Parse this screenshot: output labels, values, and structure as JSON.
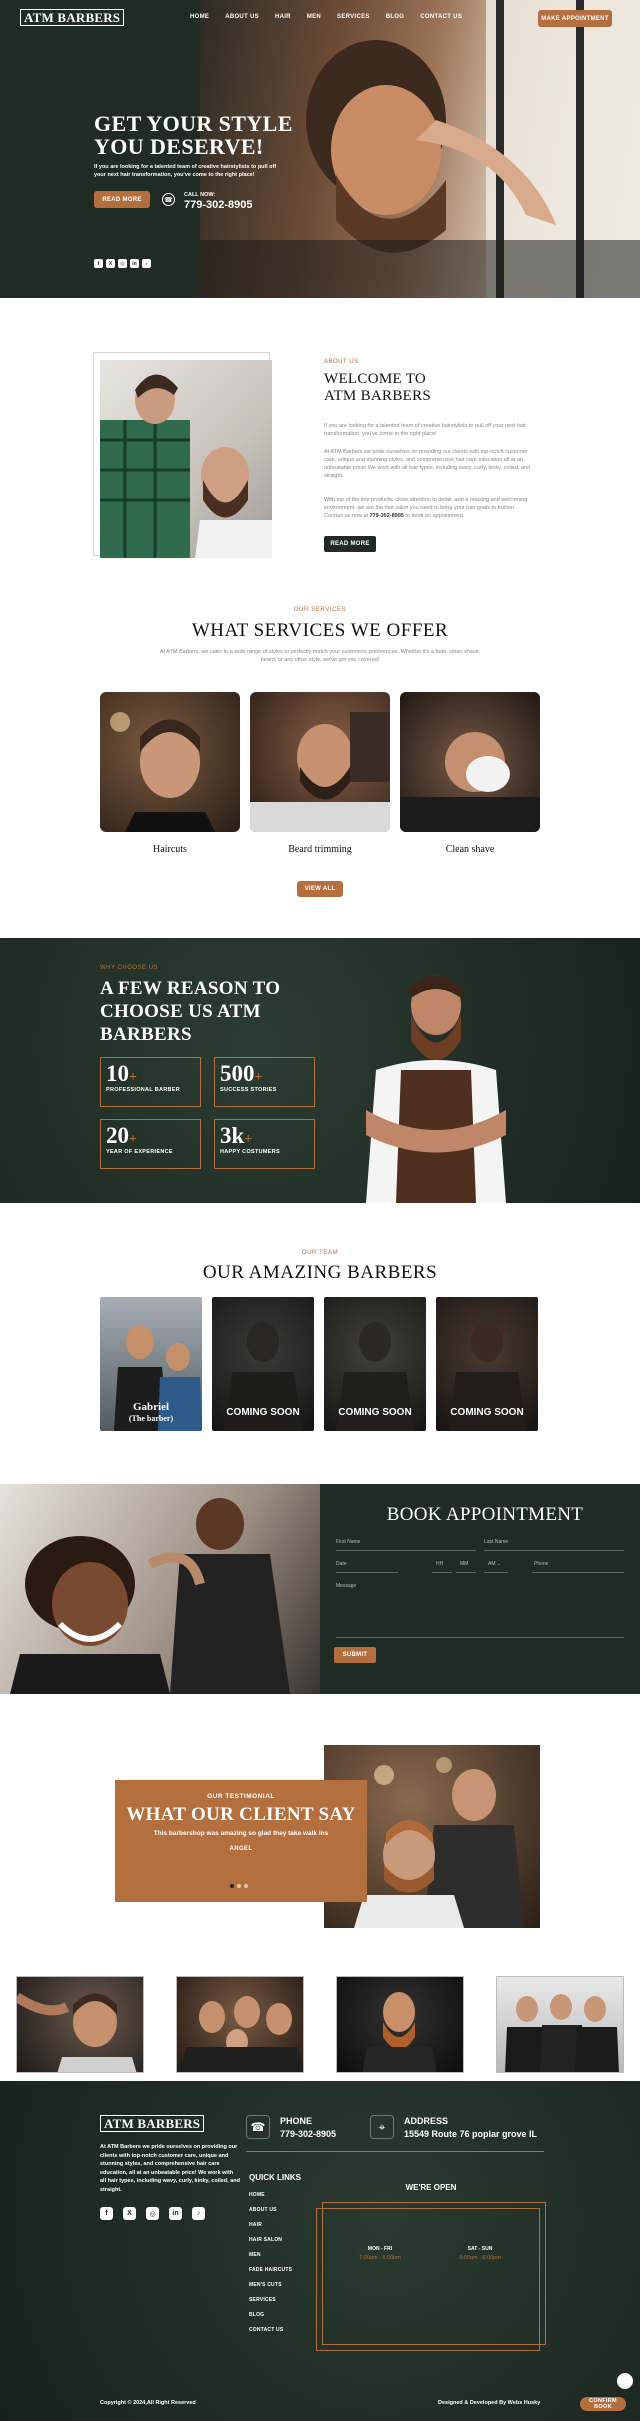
{
  "brand": {
    "logo_text": "ATM BARBERS"
  },
  "nav": {
    "items": [
      "HOME",
      "ABOUT US",
      "HAIR",
      "MEN",
      "SERVICES",
      "BLOG",
      "CONTACT US"
    ],
    "cta": "MAKE APPOINTMENT"
  },
  "hero": {
    "title_line1": "GET YOUR STYLE",
    "title_line2": "YOU DESERVE!",
    "subtitle": "If you are looking for a talented team of creative hairstylists to pull off your next hair transformation, you've come to the right place!",
    "button": "READ MORE",
    "call_label": "CALL NOW:",
    "phone": "779-302-8905",
    "social_icons": [
      "facebook-icon",
      "x-icon",
      "instagram-icon",
      "linkedin-icon",
      "tiktok-icon"
    ]
  },
  "about": {
    "eyebrow": "ABOUT US",
    "title_line1": "WELCOME TO",
    "title_line2": "ATM BARBERS",
    "para1": "If you are looking for a talented team of creative hairstylists to pull off your next hair transformation, you've come to the right place!",
    "para2": "At ATM Barbers we pride ourselves on providing our clients with top-notch customer care, unique and stunning styles, and comprehensive hair care education all at an unbeatable price! We work with all hair types, including wavy, curly, kinky, coiled, and straight.",
    "para3": "With top of the line products, close attention to detail, and a relaxing and welcoming environment, we are the hair salon you need to bring your hair goals to fruition. Contact us now at",
    "para3_phone": "779-302-8905",
    "para3_end": "to book an appointment.",
    "button": "READ MORE"
  },
  "services": {
    "eyebrow": "OUR SERVICES",
    "title": "WHAT SERVICES WE OFFER",
    "intro": "At ATM Barbers, we cater to a wide range of styles to perfectly match your customers preferences. Whether it's a fade, clean shave, beard, or any other style, we've got you covered!",
    "items": [
      "Haircuts",
      "Beard trimming",
      "Clean shave"
    ],
    "button": "VIEW ALL"
  },
  "why": {
    "eyebrow": "WHY CHOOSE US",
    "title_line1": "A FEW REASON TO",
    "title_line2": "CHOOSE US ATM",
    "title_line3": "BARBERS",
    "stats": [
      {
        "value": "10",
        "suffix": "+",
        "label": "PROFESSIONAL BARBER"
      },
      {
        "value": "500",
        "suffix": "+",
        "label": "SUCCESS STORIES"
      },
      {
        "value": "20",
        "suffix": "+",
        "label": "YEAR OF EXPERIENCE"
      },
      {
        "value": "3k",
        "suffix": "+",
        "label": "HAPPY COSTUMERS"
      }
    ]
  },
  "team": {
    "eyebrow": "OUR TEAM",
    "title": "OUR AMAZING BARBERS",
    "members": [
      {
        "name": "Gabriel",
        "role": "(The barber)"
      },
      {
        "name": "COMING SOON",
        "role": ""
      },
      {
        "name": "COMING SOON",
        "role": ""
      },
      {
        "name": "COMING SOON",
        "role": ""
      }
    ]
  },
  "booking": {
    "title": "BOOK APPOINTMENT",
    "first_name": "First Name",
    "last_name": "Last Name",
    "date": "Date",
    "hh": "HH",
    "mm": "MM",
    "ampm": "AM",
    "phone": "Phone",
    "message": "Message",
    "submit": "SUBMIT"
  },
  "testimonial": {
    "eyebrow": "OUR TESTIMONIAL",
    "title": "WHAT OUR CLIENT SAY",
    "quote": "This barbershop was amazing so glad they take walk ins",
    "author": "ANGEL"
  },
  "footer": {
    "logo_text": "ATM BARBERS",
    "about": "At ATM Barbers we pride ourselves on providing our clients with top-notch customer care, unique and stunning styles, and comprehensive hair care education, all at an unbeatable price! We work with all hair types, including wavy, curly, kinky, coiled, and straight.",
    "phone_label": "PHONE",
    "phone": "779-302-8905",
    "address_label": "ADDRESS",
    "address": "15549 Route 76 poplar grove IL",
    "quick_links_title": "QUICK LINKS",
    "quick_links": [
      "HOME",
      "ABOUT US",
      "HAIR",
      "HAIR SALON",
      "MEN",
      "FADE HAIRCUTS",
      "MEN'S CUTS",
      "SERVICES",
      "BLOG",
      "CONTACT US"
    ],
    "open_title": "WE'RE OPEN",
    "hours": [
      {
        "days": "MON - FRI",
        "time": "7:00am - 5:00pm"
      },
      {
        "days": "SAT - SUN",
        "time": "9:00am - 6:00pm"
      }
    ],
    "copyright": "Copyright © 2024,All Right Reserved",
    "credit": "Designed & Developed By Webs Husky",
    "float_button": "CONFIRM BOOK"
  }
}
